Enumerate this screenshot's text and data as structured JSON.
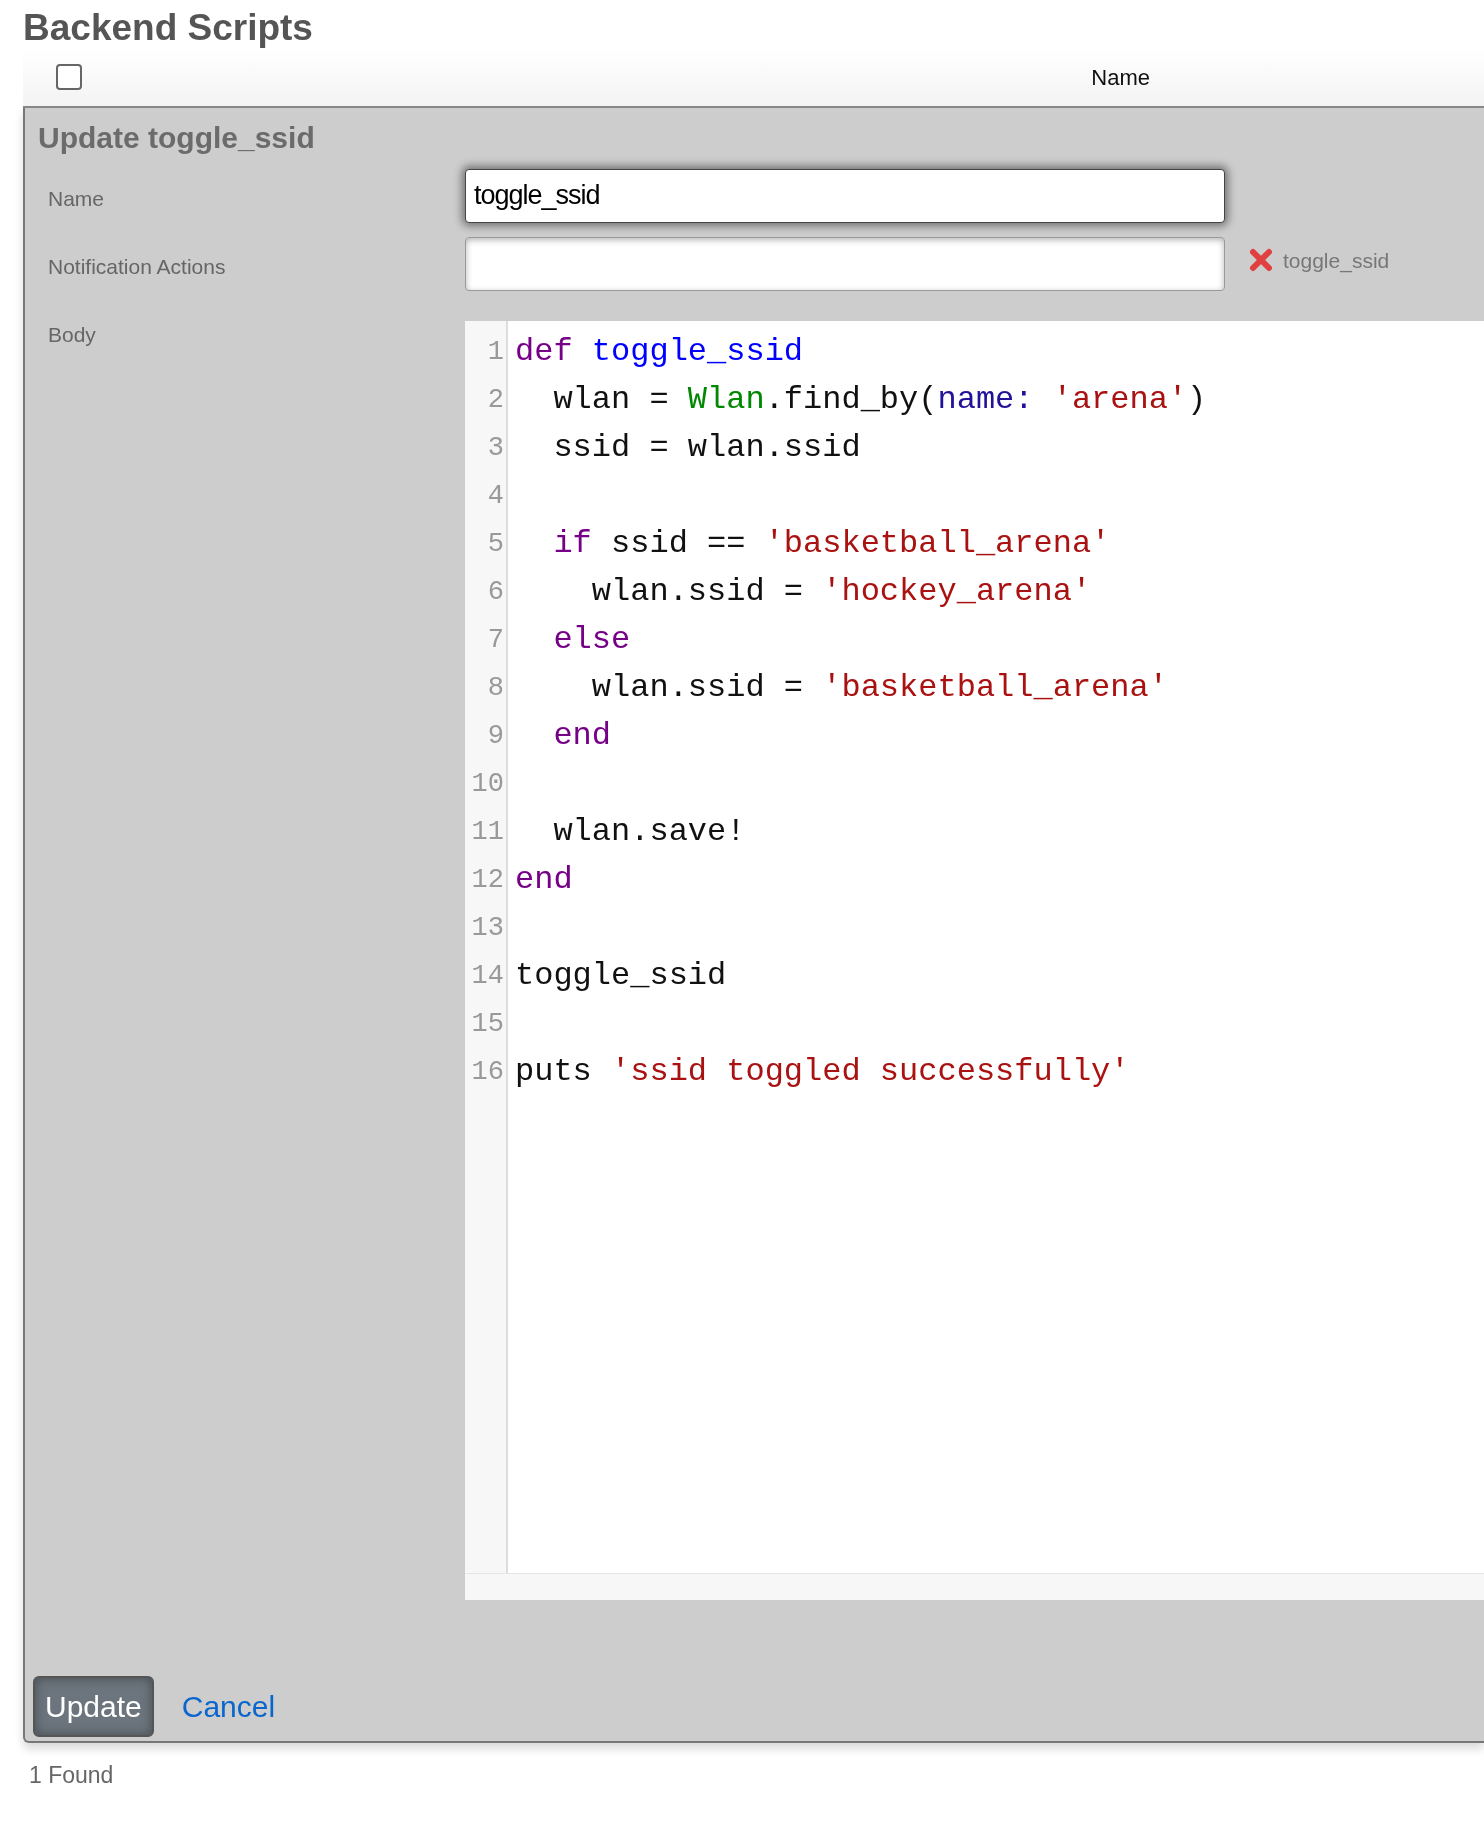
{
  "page_title": "Backend Scripts",
  "table": {
    "select_all": {
      "checked": false
    },
    "columns": [
      "Name"
    ]
  },
  "form": {
    "title": "Update toggle_ssid",
    "fields": [
      {
        "kind": "text",
        "label": "Name",
        "value": "toggle_ssid",
        "focused": true
      },
      {
        "kind": "tags",
        "label": "Notification Actions",
        "tags": [
          "toggle_ssid"
        ]
      },
      {
        "kind": "code",
        "label": "Body",
        "lines": [
          {
            "kind": "code",
            "segments": [
              {
                "text": "def ",
                "color": "#770088"
              },
              {
                "text": "toggle_ssid",
                "color": "#0000ff"
              }
            ]
          },
          {
            "kind": "code",
            "segments": [
              {
                "text": "  wlan = "
              },
              {
                "text": "Wlan",
                "color": "#008800"
              },
              {
                "text": ".find_by("
              },
              {
                "text": "name: ",
                "color": "#221199"
              },
              {
                "text": "'arena'",
                "color": "#aa1111"
              },
              {
                "text": ")"
              }
            ]
          },
          {
            "kind": "code",
            "segments": [
              {
                "text": "  ssid = wlan.ssid"
              }
            ]
          },
          {
            "kind": "blank"
          },
          {
            "kind": "code",
            "segments": [
              {
                "text": "  if",
                "color": "#770088"
              },
              {
                "text": " ssid == "
              },
              {
                "text": "'basketball_arena'",
                "color": "#aa1111"
              }
            ]
          },
          {
            "kind": "code",
            "segments": [
              {
                "text": "    wlan.ssid = "
              },
              {
                "text": "'hockey_arena'",
                "color": "#aa1111"
              }
            ]
          },
          {
            "kind": "code",
            "segments": [
              {
                "text": "  else",
                "color": "#770088"
              }
            ]
          },
          {
            "kind": "code",
            "segments": [
              {
                "text": "    wlan.ssid = "
              },
              {
                "text": "'basketball_arena'",
                "color": "#aa1111"
              }
            ]
          },
          {
            "kind": "code",
            "segments": [
              {
                "text": "  end",
                "color": "#770088"
              }
            ]
          },
          {
            "kind": "blank"
          },
          {
            "kind": "code",
            "segments": [
              {
                "text": "  wlan.save!"
              }
            ]
          },
          {
            "kind": "code",
            "segments": [
              {
                "text": "end",
                "color": "#770088"
              }
            ]
          },
          {
            "kind": "blank"
          },
          {
            "kind": "code",
            "segments": [
              {
                "text": "toggle_ssid"
              }
            ]
          },
          {
            "kind": "blank"
          },
          {
            "kind": "code",
            "segments": [
              {
                "text": "puts "
              },
              {
                "text": "'ssid toggled successfully'",
                "color": "#aa1111"
              }
            ]
          }
        ],
        "line_numbers": [
          "1",
          "2",
          "3",
          "4",
          "5",
          "6",
          "7",
          "8",
          "9",
          "10",
          "11",
          "12",
          "13",
          "14",
          "15",
          "16"
        ]
      }
    ],
    "buttons": [
      {
        "kind": "primary",
        "label": "Update"
      },
      {
        "kind": "link",
        "label": "Cancel"
      }
    ]
  },
  "footer": "1 Found"
}
